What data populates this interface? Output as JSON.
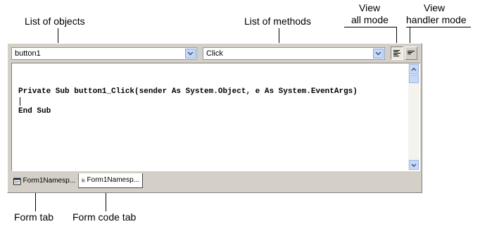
{
  "callouts": {
    "objects": "List of objects",
    "methods": "List of methods",
    "view_all_1": "View",
    "view_all_2": "all mode",
    "view_handler_1": "View",
    "view_handler_2": "handler mode",
    "form_tab": "Form tab",
    "form_code_tab": "Form code tab"
  },
  "toolbar": {
    "objects_value": "button1",
    "methods_value": "Click"
  },
  "editor": {
    "line1": "Private Sub button1_Click(sender As System.Object, e As System.EventArgs)",
    "line3": "End Sub"
  },
  "tabs": [
    {
      "label": "Form1Namesp...",
      "icon": "form-design-icon"
    },
    {
      "label": "Form1Namesp...",
      "icon": "code-file-icon"
    }
  ]
}
